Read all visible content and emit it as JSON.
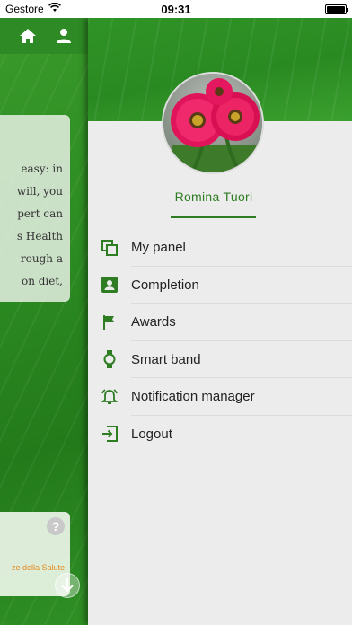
{
  "status_bar": {
    "carrier": "Gestore",
    "time": "09:31"
  },
  "background": {
    "card_lines": [
      "easy: in",
      "will, you",
      "pert can",
      "s Health",
      "rough a",
      "on diet,"
    ],
    "card2_label": "ze della Salute"
  },
  "drawer": {
    "user_name": "Romina Tuori",
    "menu": [
      {
        "label": "My panel",
        "icon": "copy-icon"
      },
      {
        "label": "Completion",
        "icon": "person-card-icon"
      },
      {
        "label": "Awards",
        "icon": "flag-icon"
      },
      {
        "label": "Smart band",
        "icon": "watch-icon"
      },
      {
        "label": "Notification manager",
        "icon": "bell-icon"
      },
      {
        "label": "Logout",
        "icon": "logout-icon"
      }
    ]
  },
  "colors": {
    "brand_green": "#2e8a24",
    "accent_green": "#2e7d23",
    "drawer_bg": "#ececec"
  }
}
